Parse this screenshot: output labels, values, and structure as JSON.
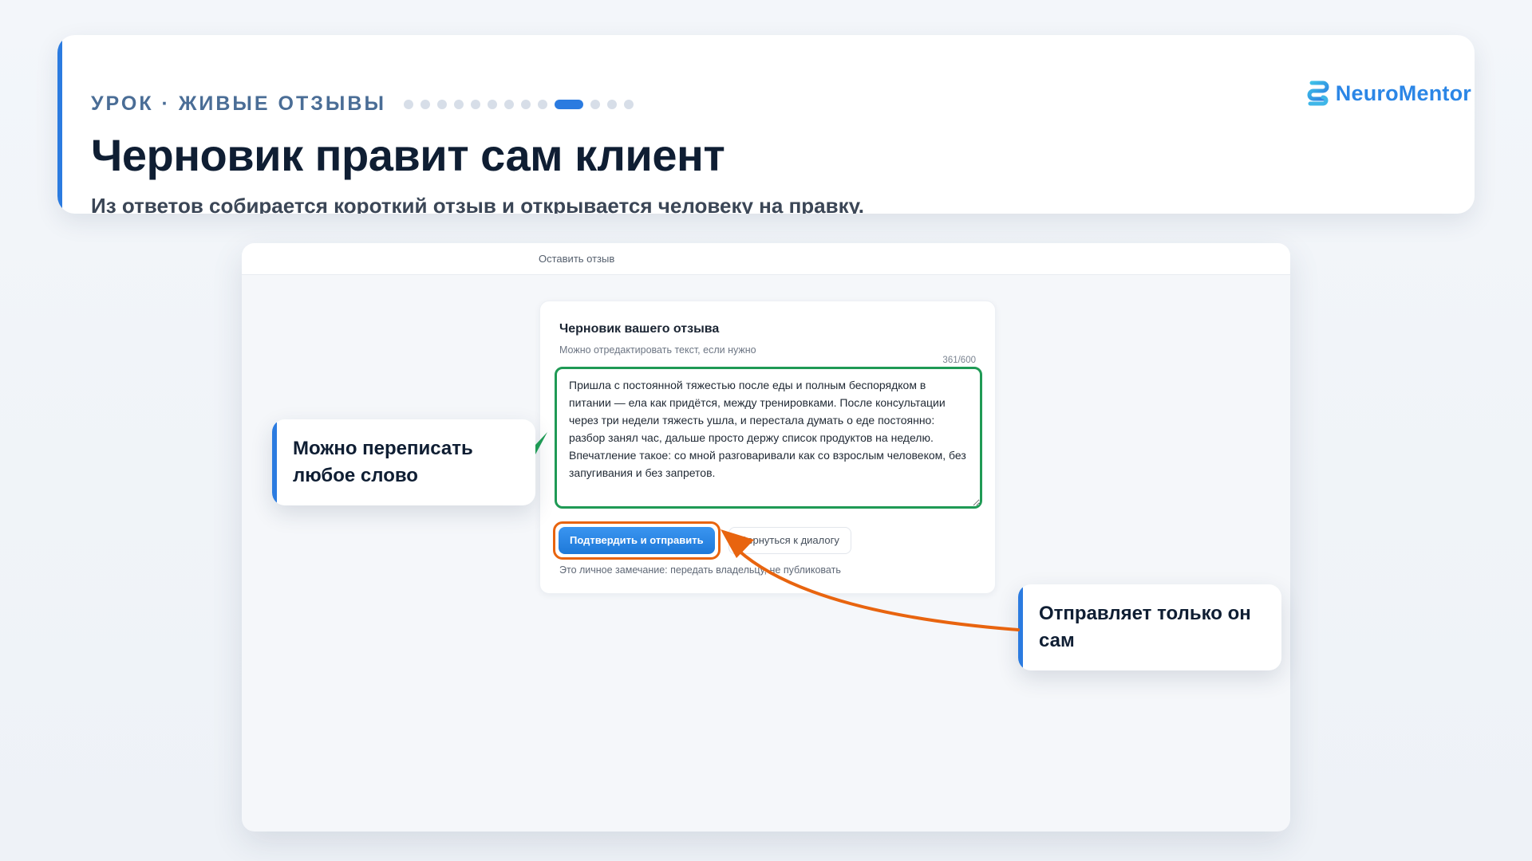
{
  "header": {
    "eyebrow": "УРОК · ЖИВЫЕ ОТЗЫВЫ",
    "title": "Черновик правит сам клиент",
    "subtitle": "Из ответов собирается короткий отзыв и открывается человеку на правку.",
    "progress": {
      "total_steps": 13,
      "current_step": 10
    }
  },
  "brand": {
    "name": "NeuroMentor",
    "color": "#2b86e6"
  },
  "app": {
    "topbar_title": "Оставить отзыв",
    "draft_card": {
      "title": "Черновик вашего отзыва",
      "hint": "Можно отредактировать текст, если нужно",
      "char_counter": "361/600",
      "text": "Пришла с постоянной тяжестью после еды и полным беспорядком в питании — ела как придётся, между тренировками. После консультации через три недели тяжесть ушла, и перестала думать о еде постоянно: разбор занял час, дальше просто держу список продуктов на неделю. Впечатление такое: со мной разговаривали как со взрослым человеком, без запугивания и без запретов.",
      "confirm_button": "Подтвердить и отправить",
      "back_button": "Вернуться к диалогу",
      "privacy_note": "Это личное замечание: передать владельцу, не публиковать"
    }
  },
  "callouts": {
    "edit": "Можно переписать любое слово",
    "send": "Отправляет только он сам"
  },
  "colors": {
    "accent": "#2b7be0",
    "textarea_highlight": "#1f9a55",
    "button_highlight": "#e8640f"
  }
}
